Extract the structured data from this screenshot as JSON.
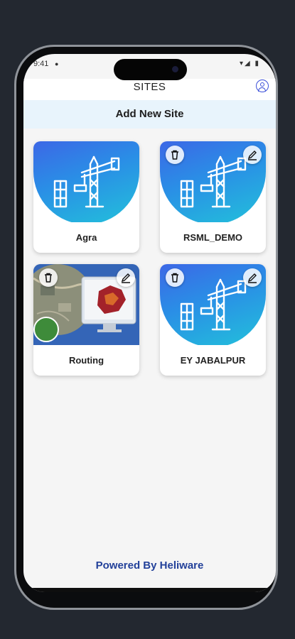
{
  "status_bar": {
    "time": "9:41",
    "indicators": "▾◢ ▮"
  },
  "app_bar": {
    "title": "SITES",
    "profile_icon": "account-circle-icon"
  },
  "add_new_site": {
    "label": "Add New Site"
  },
  "sites": [
    {
      "name": "Agra",
      "image": "crane-icon",
      "has_delete": false,
      "has_edit": false
    },
    {
      "name": "RSML_DEMO",
      "image": "crane-icon",
      "has_delete": true,
      "has_edit": true
    },
    {
      "name": "Routing",
      "image": "map-photo",
      "has_delete": true,
      "has_edit": true
    },
    {
      "name": "EY JABALPUR",
      "image": "crane-icon",
      "has_delete": true,
      "has_edit": true
    }
  ],
  "footer": {
    "text": "Powered By Heliware"
  },
  "colors": {
    "accent": "#23419a",
    "add_bar_bg": "#e8f4fc",
    "gradient_start": "#3e63e6",
    "gradient_end": "#22c2da"
  }
}
